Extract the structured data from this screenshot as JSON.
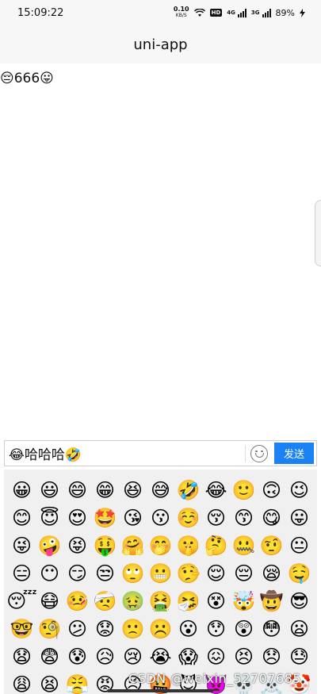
{
  "status_bar": {
    "time": "15:09:22",
    "net_speed": "0.10",
    "net_unit": "KB/S",
    "hd_label": "HD",
    "signal1_label": "4G",
    "signal2_label": "3G",
    "battery": "89%"
  },
  "nav": {
    "title": "uni-app"
  },
  "message": {
    "text": "😔666😛"
  },
  "composer": {
    "input_value": "😂哈哈哈🤣",
    "send_label": "发送"
  },
  "emojis": [
    "😀",
    "😃",
    "😄",
    "😁",
    "😆",
    "😅",
    "🤣",
    "😂",
    "🙂",
    "🙃",
    "😉",
    "😊",
    "😇",
    "😍",
    "🤩",
    "😘",
    "😗",
    "☺️",
    "😚",
    "😙",
    "😋",
    "😛",
    "😜",
    "🤪",
    "😝",
    "🤑",
    "🤗",
    "🤭",
    "🤫",
    "🤔",
    "🤐",
    "🤨",
    "😐",
    "😑",
    "😶",
    "😏",
    "😒",
    "🙄",
    "😬",
    "🤥",
    "😌",
    "😔",
    "😪",
    "🤤",
    "😴",
    "😷",
    "🤒",
    "🤕",
    "🤢",
    "🤮",
    "🤧",
    "😵",
    "🤯",
    "🤠",
    "😎",
    "🤓",
    "🧐",
    "😕",
    "😟",
    "🙁",
    "☹️",
    "😮",
    "😯",
    "😲",
    "😳",
    "😦",
    "😧",
    "😨",
    "😰",
    "😥",
    "😢",
    "😭",
    "😱",
    "😖",
    "😣",
    "😞",
    "😓",
    "😩",
    "😫",
    "😤",
    "😡",
    "😠",
    "🤬",
    "😈",
    "👿",
    "💀",
    "☠️",
    "🤡"
  ],
  "watermark": "CSDN @weixin_52707685"
}
